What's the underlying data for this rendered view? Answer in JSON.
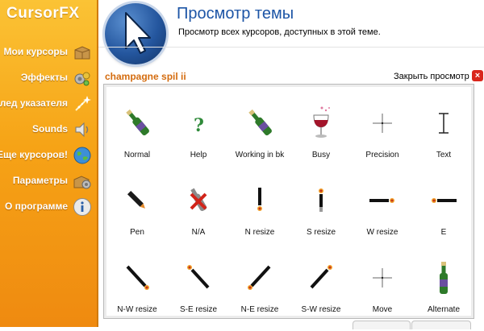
{
  "app": {
    "logo": "CursorFX"
  },
  "sidebar": {
    "items": [
      {
        "label": "Мои курсоры",
        "icon": "cardboard-box-icon"
      },
      {
        "label": "Эффекты",
        "icon": "effects-icon"
      },
      {
        "label": "След указателя",
        "icon": "sparkle-trail-icon"
      },
      {
        "label": "Sounds",
        "icon": "speaker-icon"
      },
      {
        "label": "Еще курсоров!",
        "icon": "globe-icon"
      },
      {
        "label": "Параметры",
        "icon": "gear-box-icon"
      },
      {
        "label": "О программе",
        "icon": "info-icon"
      }
    ]
  },
  "header": {
    "title": "Просмотр темы",
    "subtitle": "Просмотр всех курсоров, доступных в этой теме."
  },
  "preview": {
    "theme_name": "champagne spil ii",
    "close_label": "Закрыть просмотр",
    "cursors": [
      {
        "label": "Normal",
        "icon": "champagne-bottle-icon"
      },
      {
        "label": "Help",
        "icon": "question-mark-icon"
      },
      {
        "label": "Working in bk",
        "icon": "champagne-bottle-icon"
      },
      {
        "label": "Busy",
        "icon": "wine-glass-icon"
      },
      {
        "label": "Precision",
        "icon": "crosshair-icon"
      },
      {
        "label": "Text",
        "icon": "text-beam-icon"
      },
      {
        "label": "Pen",
        "icon": "pen-icon"
      },
      {
        "label": "N/A",
        "icon": "unavailable-icon"
      },
      {
        "label": "N resize",
        "icon": "resize-vertical-icon"
      },
      {
        "label": "S resize",
        "icon": "resize-vertical-icon"
      },
      {
        "label": "W resize",
        "icon": "resize-horizontal-icon"
      },
      {
        "label": "E",
        "icon": "resize-horizontal-icon"
      },
      {
        "label": "N-W resize",
        "icon": "resize-diagonal-nw-icon"
      },
      {
        "label": "S-E resize",
        "icon": "resize-diagonal-se-icon"
      },
      {
        "label": "N-E resize",
        "icon": "resize-diagonal-ne-icon"
      },
      {
        "label": "S-W resize",
        "icon": "resize-diagonal-sw-icon"
      },
      {
        "label": "Move",
        "icon": "move-crosshair-icon"
      },
      {
        "label": "Alternate",
        "icon": "champagne-bottle-upright-icon"
      }
    ]
  }
}
